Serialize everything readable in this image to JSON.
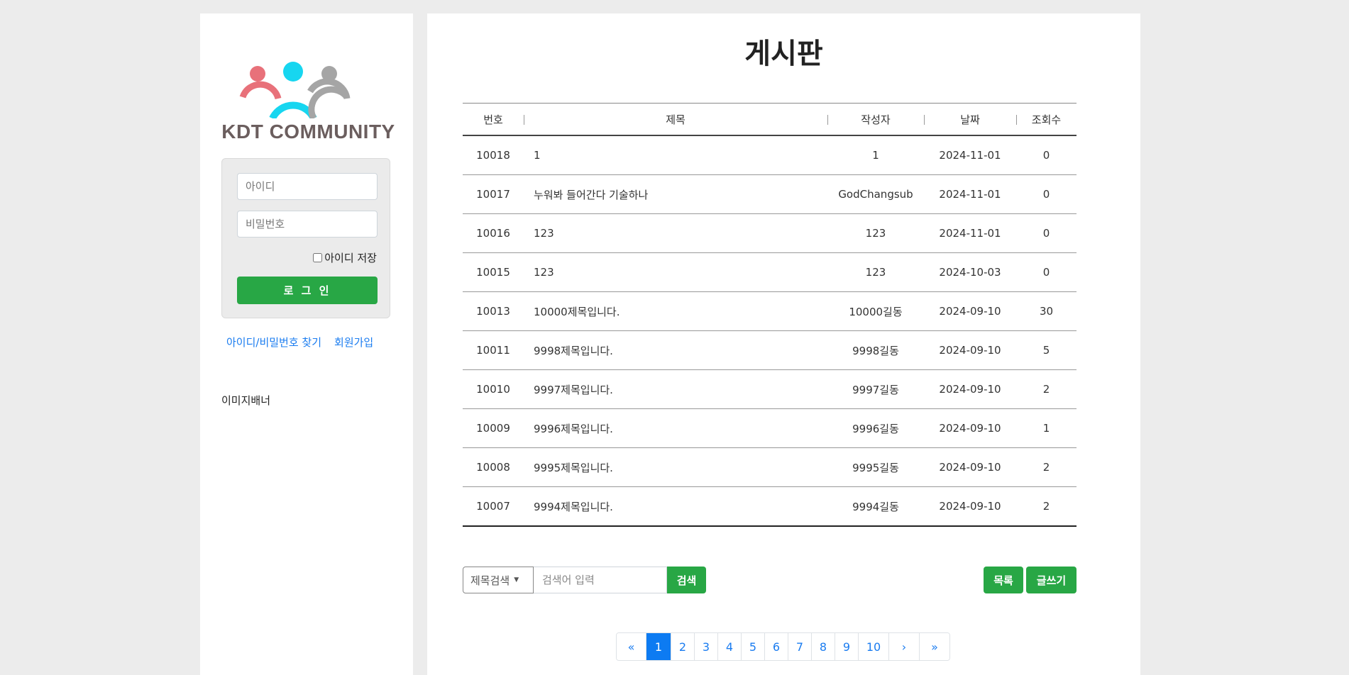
{
  "sidebar": {
    "logo_text": "KDT COMMUNITY",
    "login": {
      "id_placeholder": "아이디",
      "pw_placeholder": "비밀번호",
      "save_id_label": "아이디 저장",
      "login_button": "로 그 인"
    },
    "links": {
      "find_account": "아이디/비밀번호 찾기",
      "signup": "회원가입"
    },
    "banner_label": "이미지배너"
  },
  "main": {
    "title": "게시판",
    "columns": [
      "번호",
      "제목",
      "작성자",
      "날짜",
      "조회수"
    ],
    "rows": [
      {
        "no": "10018",
        "title": "1",
        "author": "1",
        "date": "2024-11-01",
        "views": "0"
      },
      {
        "no": "10017",
        "title": "누워봐 들어간다 기술하나",
        "author": "GodChangsub",
        "date": "2024-11-01",
        "views": "0"
      },
      {
        "no": "10016",
        "title": "123",
        "author": "123",
        "date": "2024-11-01",
        "views": "0"
      },
      {
        "no": "10015",
        "title": "123",
        "author": "123",
        "date": "2024-10-03",
        "views": "0"
      },
      {
        "no": "10013",
        "title": "10000제목입니다.",
        "author": "10000길동",
        "date": "2024-09-10",
        "views": "30"
      },
      {
        "no": "10011",
        "title": "9998제목입니다.",
        "author": "9998길동",
        "date": "2024-09-10",
        "views": "5"
      },
      {
        "no": "10010",
        "title": "9997제목입니다.",
        "author": "9997길동",
        "date": "2024-09-10",
        "views": "2"
      },
      {
        "no": "10009",
        "title": "9996제목입니다.",
        "author": "9996길동",
        "date": "2024-09-10",
        "views": "1"
      },
      {
        "no": "10008",
        "title": "9995제목입니다.",
        "author": "9995길동",
        "date": "2024-09-10",
        "views": "2"
      },
      {
        "no": "10007",
        "title": "9994제목입니다.",
        "author": "9994길동",
        "date": "2024-09-10",
        "views": "2"
      }
    ],
    "search": {
      "select_value": "제목검색",
      "input_placeholder": "검색어 입력",
      "button": "검색"
    },
    "list_button": "목록",
    "write_button": "글쓰기",
    "pagination": {
      "first": "«",
      "pages": [
        "1",
        "2",
        "3",
        "4",
        "5",
        "6",
        "7",
        "8",
        "9",
        "10"
      ],
      "active_page": "1",
      "next": "›",
      "last": "»"
    }
  },
  "colors": {
    "accent_green": "#28a745",
    "link_blue": "#1a7cf0",
    "active_page": "#0d7bf2",
    "logo_red": "#e8717a",
    "logo_cyan": "#17d6f0",
    "logo_gray": "#a5a5a5"
  }
}
